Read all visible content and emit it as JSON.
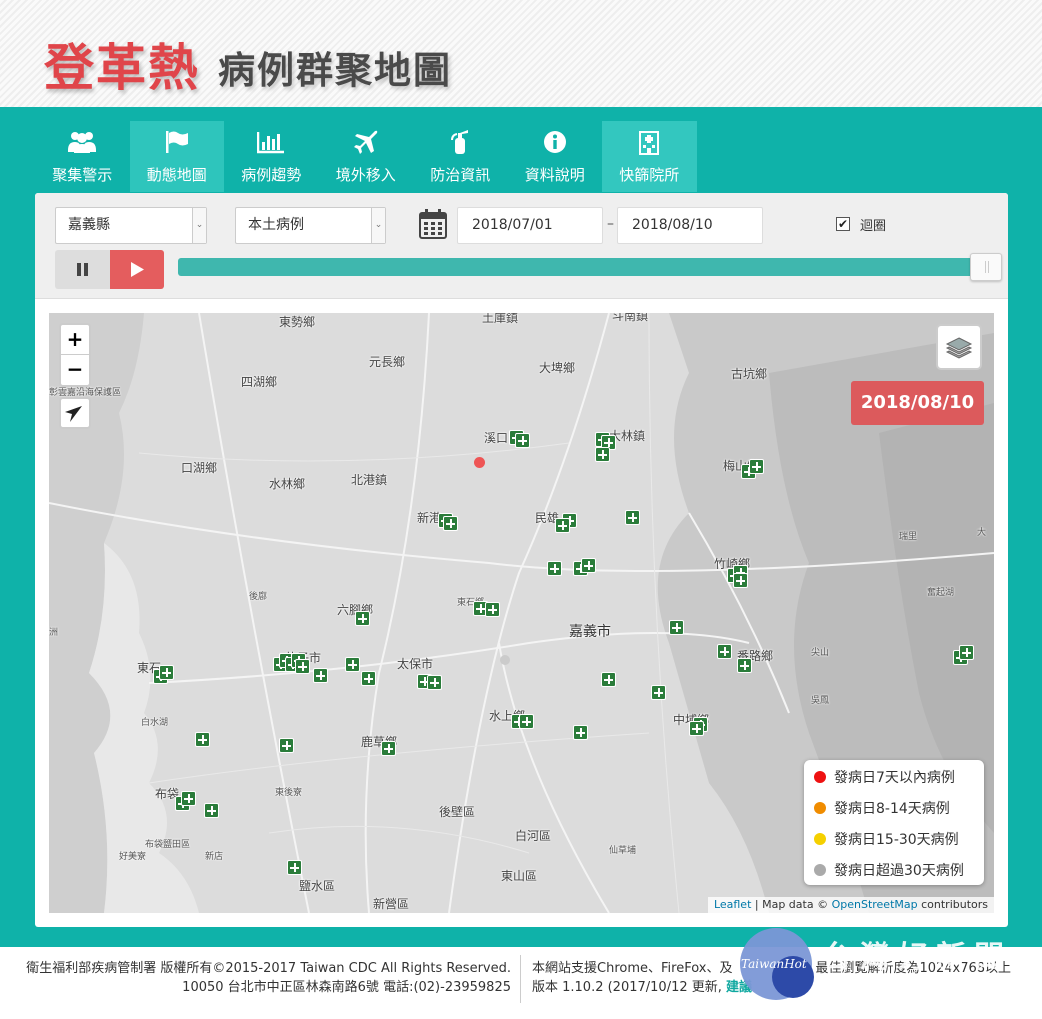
{
  "header": {
    "title": "登革熱",
    "subtitle": "病例群聚地圖"
  },
  "tabs": [
    {
      "label": "聚集警示",
      "icon": "users-icon"
    },
    {
      "label": "動態地圖",
      "icon": "flag-icon"
    },
    {
      "label": "病例趨勢",
      "icon": "bar-chart-icon"
    },
    {
      "label": "境外移入",
      "icon": "plane-icon"
    },
    {
      "label": "防治資訊",
      "icon": "fire-extinguisher-icon"
    },
    {
      "label": "資料說明",
      "icon": "info-icon"
    },
    {
      "label": "快篩院所",
      "icon": "hospital-icon"
    }
  ],
  "controls": {
    "county": "嘉義縣",
    "case_type": "本土病例",
    "date_start": "2018/07/01",
    "date_sep": "–",
    "date_end": "2018/08/10",
    "loop_label": "迴圈",
    "loop_checked": "✔",
    "progress": 1.0
  },
  "map": {
    "zoom_in": "+",
    "zoom_out": "−",
    "current_date": "2018/08/10",
    "places": [
      "東勢鄉",
      "土庫鎮",
      "斗南鎮",
      "元長鄉",
      "大埤鄉",
      "古坑鄉",
      "四湖鄉",
      "彰雲嘉沿海保護區",
      "溪口",
      "大林鎮",
      "梅山鄉",
      "口湖鄉",
      "水林鄉",
      "北港鎮",
      "新港",
      "民雄",
      "瑞里",
      "竹崎鄉",
      "奮起湖",
      "後廍",
      "六腳鄉",
      "東石鄉",
      "嘉義市",
      "太保市",
      "東石",
      "朴子市",
      "番路鄉",
      "白水湖",
      "水上鄉",
      "中埔鄉",
      "尖山",
      "吳鳳",
      "好美寮",
      "布袋",
      "鹿草鄉",
      "東後寮",
      "後壁區",
      "白河區",
      "仙草埔",
      "布袋鹽田區",
      "新店",
      "鹽水區",
      "東山區",
      "新營區",
      "大",
      "洲"
    ],
    "legend": [
      {
        "label": "發病日7天以內病例",
        "color": "#ee1111"
      },
      {
        "label": "發病日8-14天病例",
        "color": "#f08c00"
      },
      {
        "label": "發病日15-30天病例",
        "color": "#f5d000"
      },
      {
        "label": "發病日超過30天病例",
        "color": "#aaaaaa"
      }
    ],
    "attribution": {
      "leaflet": "Leaflet",
      "sep": " | Map data © ",
      "osm": "OpenStreetMap",
      "contrib": " contributors"
    }
  },
  "footer": {
    "left_line1": "衛生福利部疾病管制署 版權所有©2015-2017 Taiwan CDC All Rights Reserved.",
    "left_line2": "10050 台北市中正區林森南路6號 電話:(02)-23959825",
    "right_line1": "本網站支援Chrome、FireFox、及",
    "right_line1b": "，最佳瀏覽解析度為1024x768以上",
    "right_line2": "版本 1.10.2 (2017/10/12 更新, ",
    "right_link": "建議"
  },
  "watermark": {
    "text": "TaiwanHot",
    "big": "台灣好新聞"
  }
}
